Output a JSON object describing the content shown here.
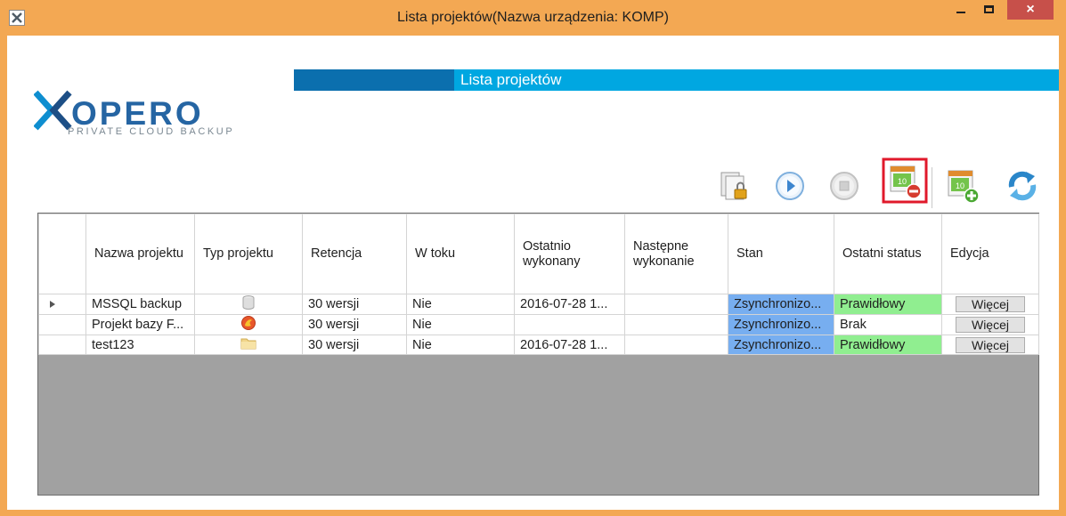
{
  "window": {
    "title": "Lista projektów(Nazwa urządzenia: KOMP)",
    "close_glyph": "×"
  },
  "banner": {
    "title": "Lista projektów"
  },
  "logo": {
    "wordmark": "XOPERO",
    "tagline": "PRIVATE CLOUD BACKUP"
  },
  "toolbar": {
    "items": [
      {
        "icon": "copy-lock-icon"
      },
      {
        "icon": "play-icon"
      },
      {
        "icon": "stop-icon"
      },
      {
        "icon": "calendar-delete-icon",
        "highlighted": true
      },
      {
        "icon": "calendar-add-icon"
      },
      {
        "icon": "refresh-icon"
      }
    ],
    "calendar_day": "10"
  },
  "table": {
    "columns": [
      "Nazwa projektu",
      "Typ projektu",
      "Retencja",
      "W toku",
      "Ostatnio wykonany",
      "Następne wykonanie",
      "Stan",
      "Ostatni status",
      "Edycja"
    ],
    "rows": [
      {
        "name": "MSSQL backup",
        "type_icon": "database-icon",
        "retention": "30 wersji",
        "in_progress": "Nie",
        "last_run": "2016-07-28 1...",
        "next_run": "",
        "state": "Zsynchronizo...",
        "last_status": "Prawidłowy",
        "edit": "Więcej",
        "selected": true
      },
      {
        "name": "Projekt bazy F...",
        "type_icon": "firebird-icon",
        "retention": "30 wersji",
        "in_progress": "Nie",
        "last_run": "",
        "next_run": "",
        "state": "Zsynchronizo...",
        "last_status": "Brak",
        "edit": "Więcej",
        "selected": false
      },
      {
        "name": "test123",
        "type_icon": "folder-icon",
        "retention": "30 wersji",
        "in_progress": "Nie",
        "last_run": "2016-07-28 1...",
        "next_run": "",
        "state": "Zsynchronizo...",
        "last_status": "Prawidłowy",
        "edit": "Więcej",
        "selected": false
      }
    ]
  },
  "colors": {
    "frame": "#f3a853",
    "banner_light": "#00a7e1",
    "banner_dark": "#0b6fae",
    "state_cell": "#77aef0",
    "status_ok": "#90ee90",
    "grid_empty": "#a1a1a1",
    "highlight_border": "#e0192b"
  }
}
